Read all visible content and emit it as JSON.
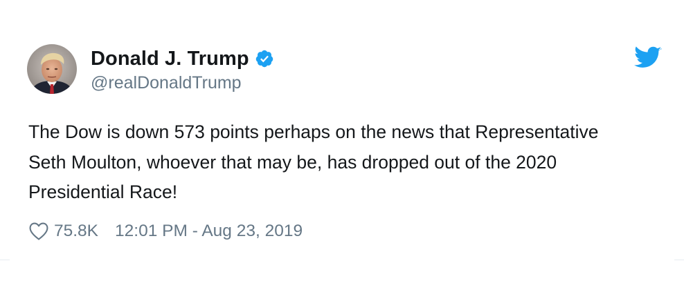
{
  "tweet": {
    "author": {
      "display_name": "Donald J. Trump",
      "handle": "@realDonaldTrump",
      "verified": true,
      "avatar_icon": "user-avatar-photo"
    },
    "text": "The Dow is down 573 points perhaps on the news that Representative Seth Moulton, whoever that may be, has dropped out of the 2020 Presidential Race!",
    "likes": "75.8K",
    "timestamp": "12:01 PM - Aug 23, 2019"
  },
  "icons": {
    "verified": "verified-badge-icon",
    "platform": "twitter-bird-icon",
    "like": "heart-icon"
  },
  "colors": {
    "brand_blue": "#1da1f2",
    "text_primary": "#14171a",
    "text_secondary": "#657786"
  }
}
